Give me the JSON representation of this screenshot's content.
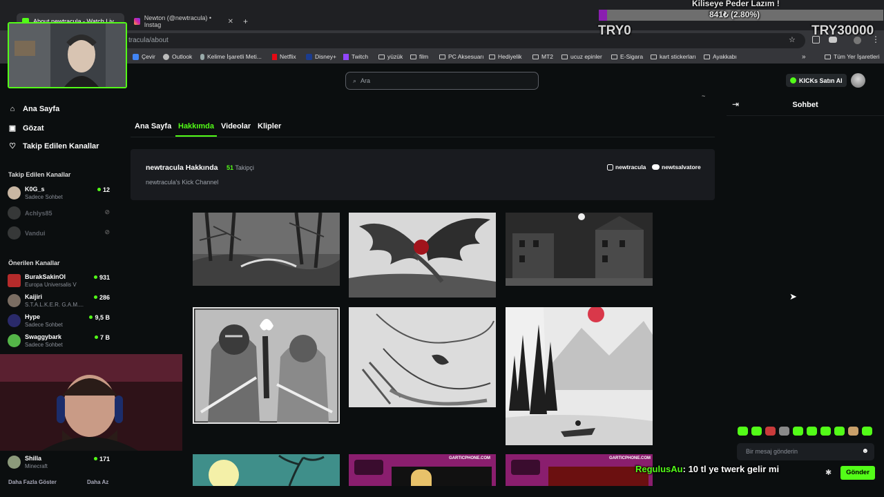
{
  "browser": {
    "tabs": [
      {
        "label": "About newtracula - Watch Liv",
        "active": true
      },
      {
        "label": "Newton (@newtracula) • Instag",
        "active": false
      }
    ],
    "new_tab": "+",
    "url": "tracula/about",
    "bookmarks": [
      {
        "label": "Çevir"
      },
      {
        "label": "Outlook"
      },
      {
        "label": "Kelime İşaretli Meti..."
      },
      {
        "label": "Netflix"
      },
      {
        "label": "Disney+"
      },
      {
        "label": "Twitch"
      },
      {
        "label": "yüzük"
      },
      {
        "label": "film"
      },
      {
        "label": "PC Aksesuarı"
      },
      {
        "label": "Hediyelik"
      },
      {
        "label": "MT2"
      },
      {
        "label": "ucuz epinler"
      },
      {
        "label": "E-Sigara"
      },
      {
        "label": "kart stickerları"
      },
      {
        "label": "Ayakkabı"
      }
    ],
    "overflow": "»",
    "all_bookmarks": "Tüm Yer İşaretleri"
  },
  "sidebar": {
    "nav": [
      {
        "label": "Ana Sayfa",
        "icon": "home-icon"
      },
      {
        "label": "Gözat",
        "icon": "browse-icon"
      },
      {
        "label": "Takip Edilen Kanallar",
        "icon": "heart-icon"
      }
    ],
    "followed_title": "Takip Edilen Kanallar",
    "followed": [
      {
        "name": "K0G_s",
        "sub": "Sadece Sohbet",
        "count": "12",
        "live": true
      },
      {
        "name": "Achlys85",
        "sub": "",
        "count": "",
        "live": false
      },
      {
        "name": "Vandui",
        "sub": "",
        "count": "",
        "live": false
      }
    ],
    "recommended_title": "Önerilen Kanallar",
    "recommended": [
      {
        "name": "BurakSakinOl",
        "sub": "Europa Universalis V",
        "count": "931"
      },
      {
        "name": "Kaijiri",
        "sub": "S.T.A.L.K.E.R. G.A.M....",
        "count": "286"
      },
      {
        "name": "Hype",
        "sub": "Sadece Sohbet",
        "count": "9,5 B"
      },
      {
        "name": "Swaggybark",
        "sub": "Sadece Sohbet",
        "count": "7 B"
      },
      {
        "name": "Shilla",
        "sub": "Minecraft",
        "count": "171"
      }
    ],
    "show_more": "Daha Fazla Göster",
    "show_less": "Daha Az"
  },
  "header": {
    "search_placeholder": "Ara",
    "buy_kicks": "KICKs Satın Al"
  },
  "channel": {
    "tabs": [
      "Ana Sayfa",
      "Hakkımda",
      "Videolar",
      "Klipler"
    ],
    "active_tab": "Hakkımda",
    "about_title": "newtracula Hakkında",
    "followers_count": "51",
    "followers_label": "Takipçi",
    "description": "newtracula's Kick Channel",
    "socials": [
      {
        "label": "newtracula",
        "icon": "instagram-icon"
      },
      {
        "label": "newtsalvatore",
        "icon": "discord-icon"
      }
    ]
  },
  "panels": [
    {
      "kind": "drawing",
      "subject": "forest-bridge"
    },
    {
      "kind": "drawing",
      "subject": "winged-figure"
    },
    {
      "kind": "drawing",
      "subject": "night-town"
    },
    {
      "kind": "drawing",
      "subject": "knights"
    },
    {
      "kind": "drawing",
      "subject": "face-sketch"
    },
    {
      "kind": "drawing",
      "subject": "ink-landscape"
    },
    {
      "kind": "drawing",
      "subject": "moon-tree"
    },
    {
      "kind": "drawing",
      "subject": "garticphone-1",
      "caption": "GARTICPHONE.COM"
    },
    {
      "kind": "drawing",
      "subject": "garticphone-2",
      "caption": "GARTICPHONE.COM"
    }
  ],
  "chat": {
    "title": "Sohbet",
    "input_placeholder": "Bir mesaj gönderin",
    "send_label": "Gönder"
  },
  "stream_overlay": {
    "goal_title": "Kiliseye Peder Lazım !",
    "goal_progress": "841₺ (2.80%)",
    "goal_fraction": 0.028,
    "goal_min": "TRY0",
    "goal_max": "TRY30000",
    "chat_user": "RegulusAu",
    "chat_message": ": 10 tl ye twerk gelir mi"
  },
  "colors": {
    "accent": "#53fc18",
    "background": "#0b0e0f",
    "card": "#191b1f"
  }
}
